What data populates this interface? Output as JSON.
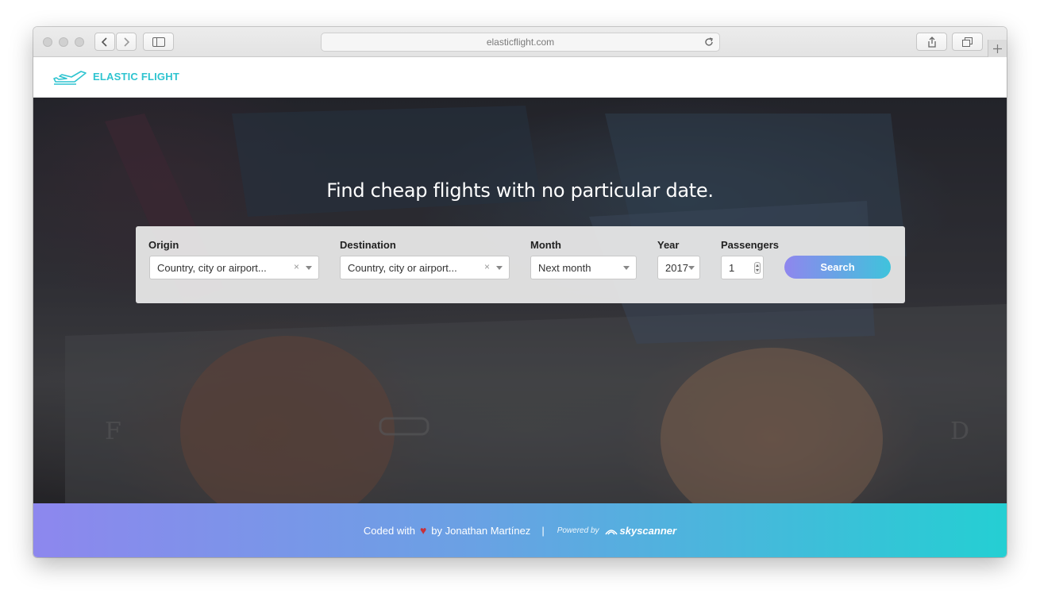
{
  "browser": {
    "url": "elasticflight.com"
  },
  "header": {
    "logo_text": "ELASTIC FLIGHT"
  },
  "hero": {
    "title": "Find cheap flights with no particular date."
  },
  "search": {
    "origin_label": "Origin",
    "origin_placeholder": "Country, city or airport...",
    "destination_label": "Destination",
    "destination_placeholder": "Country, city or airport...",
    "month_label": "Month",
    "month_value": "Next month",
    "year_label": "Year",
    "year_value": "2017",
    "passengers_label": "Passengers",
    "passengers_value": "1",
    "button_label": "Search",
    "clear_symbol": "×"
  },
  "footer": {
    "coded_with": "Coded with",
    "by_text": "by Jonathan Martínez",
    "separator": "|",
    "powered_by": "Powered by",
    "partner": "skyscanner"
  },
  "colors": {
    "brand": "#2ec4d0",
    "button_start": "#8f86ee",
    "button_end": "#3fc3dc",
    "heart": "#c8303a"
  }
}
